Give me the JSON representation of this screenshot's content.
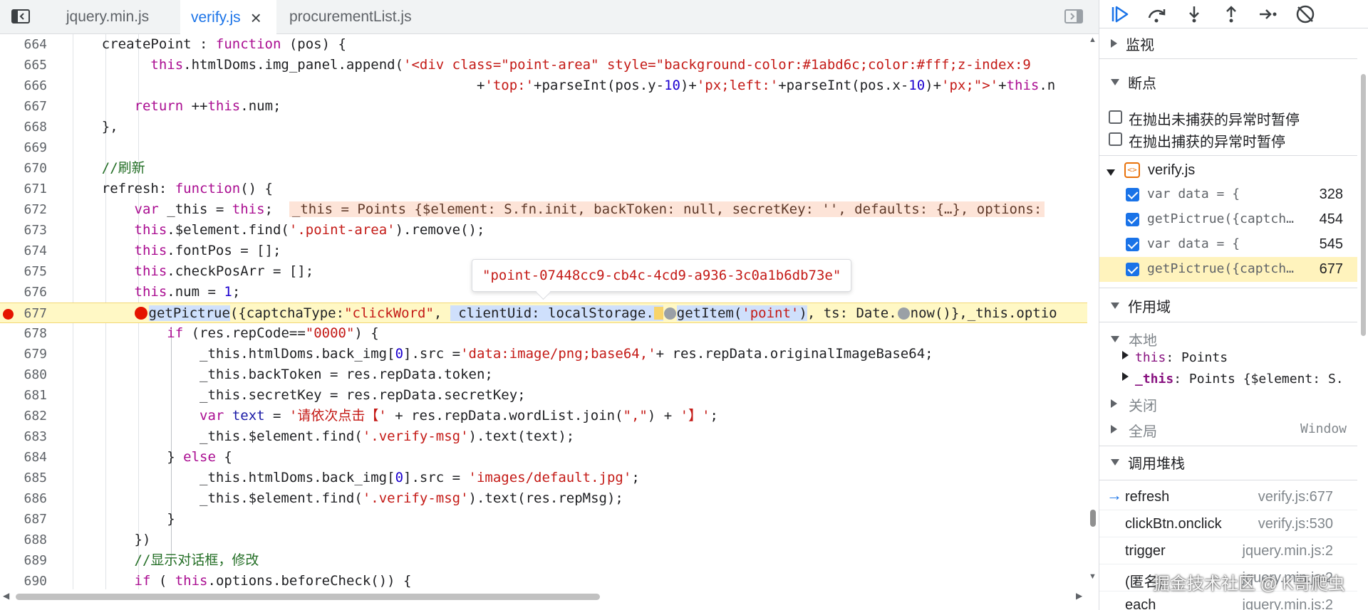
{
  "tabs": [
    {
      "label": "jquery.min.js",
      "active": false
    },
    {
      "label": "verify.js",
      "active": true
    },
    {
      "label": "procurementList.js",
      "active": false
    }
  ],
  "editor": {
    "lines": [
      {
        "n": "664"
      },
      {
        "n": "665"
      },
      {
        "n": "666"
      },
      {
        "n": "667"
      },
      {
        "n": "668"
      },
      {
        "n": "669"
      },
      {
        "n": "670"
      },
      {
        "n": "671"
      },
      {
        "n": "672"
      },
      {
        "n": "673"
      },
      {
        "n": "674"
      },
      {
        "n": "675"
      },
      {
        "n": "676"
      },
      {
        "n": "677"
      },
      {
        "n": "678"
      },
      {
        "n": "679"
      },
      {
        "n": "680"
      },
      {
        "n": "681"
      },
      {
        "n": "682"
      },
      {
        "n": "683"
      },
      {
        "n": "684"
      },
      {
        "n": "685"
      },
      {
        "n": "686"
      },
      {
        "n": "687"
      },
      {
        "n": "688"
      },
      {
        "n": "689"
      },
      {
        "n": "690"
      }
    ],
    "current_line": "677",
    "tooltip": "\"point-07448cc9-cb4c-4cd9-a936-3c0a1b6db73e\""
  },
  "panel": {
    "watch": "监视",
    "breakpoints": "断点",
    "pause_uncaught": "在抛出未捕获的异常时暂停",
    "pause_caught": "在抛出捕获的异常时暂停",
    "file": "verify.js",
    "bps": [
      {
        "code": "var data = {",
        "line": "328"
      },
      {
        "code": "getPictrue({captch…",
        "line": "454"
      },
      {
        "code": "var data = {",
        "line": "545"
      },
      {
        "code": "getPictrue({captch…",
        "line": "677"
      }
    ],
    "scope": "作用域",
    "local": "本地",
    "this_key": "this",
    "this_val": "Points",
    "_this_key": "_this",
    "_this_val": "Points {$element: S.",
    "closure": "关闭",
    "global": "全局",
    "global_val": "Window",
    "callstack": "调用堆栈",
    "frames": [
      {
        "fn": "refresh",
        "loc": "verify.js:677"
      },
      {
        "fn": "clickBtn.onclick",
        "loc": "verify.js:530"
      },
      {
        "fn": "trigger",
        "loc": "jquery.min.js:2"
      },
      {
        "fn": "(匿名)",
        "loc": "jquery.min.js:2"
      },
      {
        "fn": "each",
        "loc": "jquery.min.js:2"
      }
    ]
  },
  "watermark": "掘金技术社区 @ K哥爬虫",
  "colors": {
    "accent": "#1a73e8",
    "breakpoint": "#e51400",
    "current_line": "#fff8c5"
  }
}
